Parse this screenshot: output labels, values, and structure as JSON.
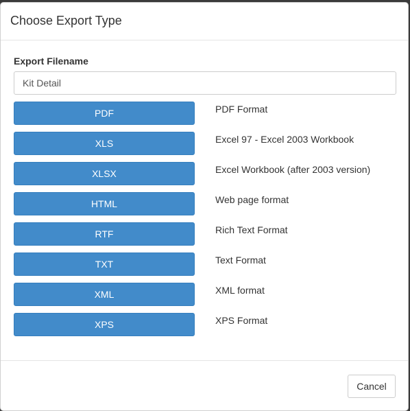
{
  "dialog": {
    "title": "Choose Export Type"
  },
  "filename": {
    "label": "Export Filename",
    "value": "Kit Detail"
  },
  "export_types": [
    {
      "label": "PDF",
      "description": "PDF Format"
    },
    {
      "label": "XLS",
      "description": "Excel 97 - Excel 2003 Workbook"
    },
    {
      "label": "XLSX",
      "description": "Excel Workbook (after 2003 version)"
    },
    {
      "label": "HTML",
      "description": "Web page format"
    },
    {
      "label": "RTF",
      "description": "Rich Text Format"
    },
    {
      "label": "TXT",
      "description": "Text Format"
    },
    {
      "label": "XML",
      "description": "XML format"
    },
    {
      "label": "XPS",
      "description": "XPS Format"
    }
  ],
  "footer": {
    "cancel_label": "Cancel"
  },
  "colors": {
    "primary_button": "#428bca",
    "primary_button_border": "#357ebd",
    "text": "#333333"
  }
}
